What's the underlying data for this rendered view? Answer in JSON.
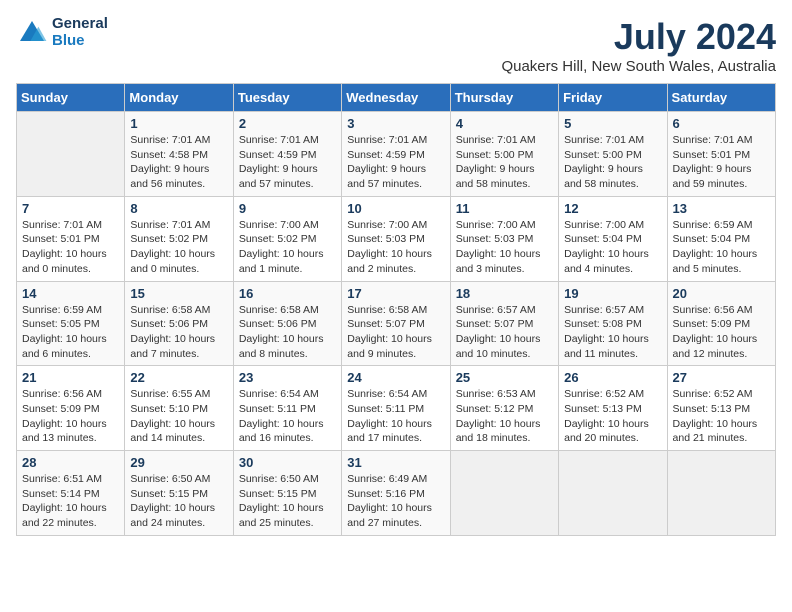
{
  "logo": {
    "line1": "General",
    "line2": "Blue"
  },
  "title": "July 2024",
  "location": "Quakers Hill, New South Wales, Australia",
  "days_of_week": [
    "Sunday",
    "Monday",
    "Tuesday",
    "Wednesday",
    "Thursday",
    "Friday",
    "Saturday"
  ],
  "weeks": [
    [
      {
        "day": "",
        "info": ""
      },
      {
        "day": "1",
        "info": "Sunrise: 7:01 AM\nSunset: 4:58 PM\nDaylight: 9 hours\nand 56 minutes."
      },
      {
        "day": "2",
        "info": "Sunrise: 7:01 AM\nSunset: 4:59 PM\nDaylight: 9 hours\nand 57 minutes."
      },
      {
        "day": "3",
        "info": "Sunrise: 7:01 AM\nSunset: 4:59 PM\nDaylight: 9 hours\nand 57 minutes."
      },
      {
        "day": "4",
        "info": "Sunrise: 7:01 AM\nSunset: 5:00 PM\nDaylight: 9 hours\nand 58 minutes."
      },
      {
        "day": "5",
        "info": "Sunrise: 7:01 AM\nSunset: 5:00 PM\nDaylight: 9 hours\nand 58 minutes."
      },
      {
        "day": "6",
        "info": "Sunrise: 7:01 AM\nSunset: 5:01 PM\nDaylight: 9 hours\nand 59 minutes."
      }
    ],
    [
      {
        "day": "7",
        "info": "Sunrise: 7:01 AM\nSunset: 5:01 PM\nDaylight: 10 hours\nand 0 minutes."
      },
      {
        "day": "8",
        "info": "Sunrise: 7:01 AM\nSunset: 5:02 PM\nDaylight: 10 hours\nand 0 minutes."
      },
      {
        "day": "9",
        "info": "Sunrise: 7:00 AM\nSunset: 5:02 PM\nDaylight: 10 hours\nand 1 minute."
      },
      {
        "day": "10",
        "info": "Sunrise: 7:00 AM\nSunset: 5:03 PM\nDaylight: 10 hours\nand 2 minutes."
      },
      {
        "day": "11",
        "info": "Sunrise: 7:00 AM\nSunset: 5:03 PM\nDaylight: 10 hours\nand 3 minutes."
      },
      {
        "day": "12",
        "info": "Sunrise: 7:00 AM\nSunset: 5:04 PM\nDaylight: 10 hours\nand 4 minutes."
      },
      {
        "day": "13",
        "info": "Sunrise: 6:59 AM\nSunset: 5:04 PM\nDaylight: 10 hours\nand 5 minutes."
      }
    ],
    [
      {
        "day": "14",
        "info": "Sunrise: 6:59 AM\nSunset: 5:05 PM\nDaylight: 10 hours\nand 6 minutes."
      },
      {
        "day": "15",
        "info": "Sunrise: 6:58 AM\nSunset: 5:06 PM\nDaylight: 10 hours\nand 7 minutes."
      },
      {
        "day": "16",
        "info": "Sunrise: 6:58 AM\nSunset: 5:06 PM\nDaylight: 10 hours\nand 8 minutes."
      },
      {
        "day": "17",
        "info": "Sunrise: 6:58 AM\nSunset: 5:07 PM\nDaylight: 10 hours\nand 9 minutes."
      },
      {
        "day": "18",
        "info": "Sunrise: 6:57 AM\nSunset: 5:07 PM\nDaylight: 10 hours\nand 10 minutes."
      },
      {
        "day": "19",
        "info": "Sunrise: 6:57 AM\nSunset: 5:08 PM\nDaylight: 10 hours\nand 11 minutes."
      },
      {
        "day": "20",
        "info": "Sunrise: 6:56 AM\nSunset: 5:09 PM\nDaylight: 10 hours\nand 12 minutes."
      }
    ],
    [
      {
        "day": "21",
        "info": "Sunrise: 6:56 AM\nSunset: 5:09 PM\nDaylight: 10 hours\nand 13 minutes."
      },
      {
        "day": "22",
        "info": "Sunrise: 6:55 AM\nSunset: 5:10 PM\nDaylight: 10 hours\nand 14 minutes."
      },
      {
        "day": "23",
        "info": "Sunrise: 6:54 AM\nSunset: 5:11 PM\nDaylight: 10 hours\nand 16 minutes."
      },
      {
        "day": "24",
        "info": "Sunrise: 6:54 AM\nSunset: 5:11 PM\nDaylight: 10 hours\nand 17 minutes."
      },
      {
        "day": "25",
        "info": "Sunrise: 6:53 AM\nSunset: 5:12 PM\nDaylight: 10 hours\nand 18 minutes."
      },
      {
        "day": "26",
        "info": "Sunrise: 6:52 AM\nSunset: 5:13 PM\nDaylight: 10 hours\nand 20 minutes."
      },
      {
        "day": "27",
        "info": "Sunrise: 6:52 AM\nSunset: 5:13 PM\nDaylight: 10 hours\nand 21 minutes."
      }
    ],
    [
      {
        "day": "28",
        "info": "Sunrise: 6:51 AM\nSunset: 5:14 PM\nDaylight: 10 hours\nand 22 minutes."
      },
      {
        "day": "29",
        "info": "Sunrise: 6:50 AM\nSunset: 5:15 PM\nDaylight: 10 hours\nand 24 minutes."
      },
      {
        "day": "30",
        "info": "Sunrise: 6:50 AM\nSunset: 5:15 PM\nDaylight: 10 hours\nand 25 minutes."
      },
      {
        "day": "31",
        "info": "Sunrise: 6:49 AM\nSunset: 5:16 PM\nDaylight: 10 hours\nand 27 minutes."
      },
      {
        "day": "",
        "info": ""
      },
      {
        "day": "",
        "info": ""
      },
      {
        "day": "",
        "info": ""
      }
    ]
  ]
}
